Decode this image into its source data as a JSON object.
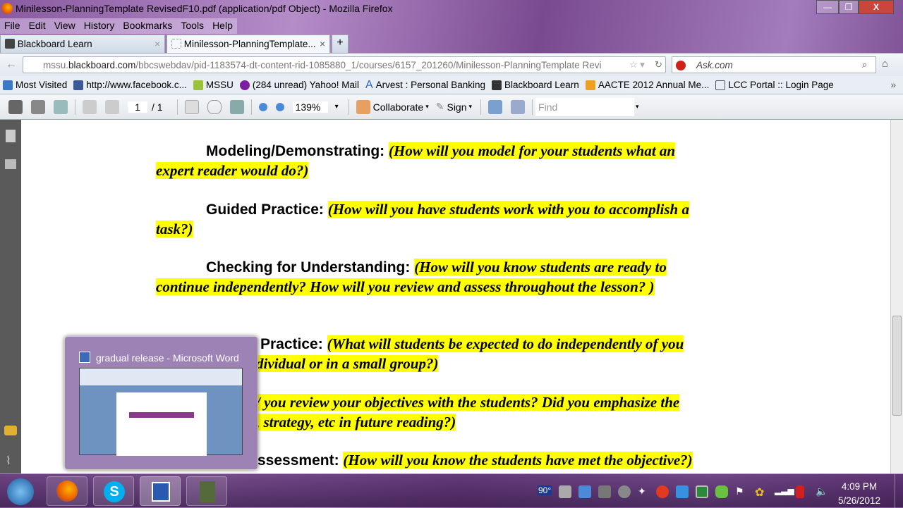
{
  "window": {
    "title": "Minilesson-PlanningTemplate RevisedF10.pdf (application/pdf Object) - Mozilla Firefox",
    "controls": {
      "minimize": "—",
      "restore": "❐",
      "close": "X"
    }
  },
  "menu": [
    "File",
    "Edit",
    "View",
    "History",
    "Bookmarks",
    "Tools",
    "Help"
  ],
  "tabs": [
    {
      "label": "Blackboard Learn",
      "close": "×"
    },
    {
      "label": "Minilesson-PlanningTemplate...",
      "close": "×"
    }
  ],
  "new_tab": "+",
  "nav": {
    "url_host_prefix": "mssu.",
    "url_host_domain": "blackboard.com",
    "url_path": "/bbcswebdav/pid-1183574-dt-content-rid-1085880_1/courses/6157_201260/Minilesson-PlanningTemplate Revi",
    "search_placeholder": "Ask.com"
  },
  "bookmarks": [
    {
      "label": "Most Visited",
      "color": "#3a78c8"
    },
    {
      "label": "http://www.facebook.c...",
      "color": "#3b5998"
    },
    {
      "label": "MSSU",
      "color": "#9bc23a"
    },
    {
      "label": "(284 unread) Yahoo! Mail",
      "color": "#7b1fa2"
    },
    {
      "label": "Arvest : Personal Banking",
      "color": "#2a6ab8"
    },
    {
      "label": "Blackboard Learn",
      "color": "#333"
    },
    {
      "label": "AACTE 2012 Annual Me...",
      "color": "#f0a020"
    },
    {
      "label": "LCC Portal :: Login Page",
      "color": "#556"
    }
  ],
  "bookmarks_more": "»",
  "pdf_toolbar": {
    "page": "1",
    "page_total": "/ 1",
    "zoom": "139%",
    "collaborate": "Collaborate",
    "sign": "Sign",
    "find_placeholder": "Find"
  },
  "document": [
    {
      "heading": "Modeling/Demonstrating:",
      "q1": "(How will you model for your students what an",
      "q2": "expert reader would do?)"
    },
    {
      "heading": "Guided Practice:",
      "q1": "(How will you have students work with you to accomplish a",
      "q2": "task?)"
    },
    {
      "heading": "Checking for Understanding:",
      "q1": "(How will you know students are ready to",
      "q2": "continue independently? How will you review and assess throughout the lesson? )"
    },
    {
      "heading": "Practice:",
      "q1": "(What will students be expected to do independently of you",
      "q2": "dividual or in a small group?)"
    },
    {
      "q1": "/ you review your objectives with the students? Did you emphasize the",
      "q2": ", strategy, etc in future reading?)"
    },
    {
      "heading": "ssessment:",
      "q1": "(How will you know the students have met the objective?)"
    }
  ],
  "popup": {
    "title": "gradual release - Microsoft Word"
  },
  "taskbar": {
    "apps": [
      "Firefox",
      "Skype",
      "Microsoft Word",
      "Camtasia"
    ],
    "weather": "90°",
    "time": "4:09 PM",
    "date": "5/26/2012"
  }
}
